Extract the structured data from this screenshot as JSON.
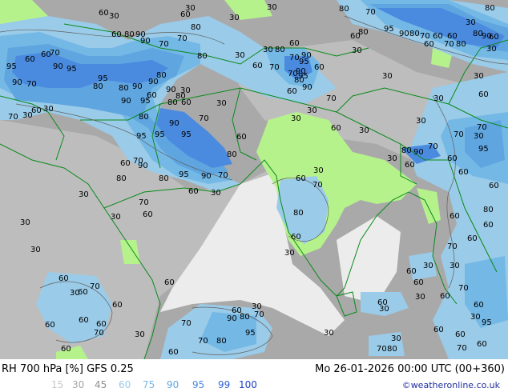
{
  "title": "RH 700 hPa [%] GFS 0.25",
  "run_info": "Mo 26-01-2026 00:00 UTC (00+360)",
  "credit": "©weatheronline.co.uk",
  "legend": [
    {
      "label": "15",
      "color": "#c8c8c8"
    },
    {
      "label": "30",
      "color": "#a5a5a5"
    },
    {
      "label": "45",
      "color": "#8f8f8f"
    },
    {
      "label": "60",
      "color": "#9acbe8"
    },
    {
      "label": "75",
      "color": "#74b8e6"
    },
    {
      "label": "90",
      "color": "#5fa5e0"
    },
    {
      "label": "95",
      "color": "#4a8be0"
    },
    {
      "label": "99",
      "color": "#2e62d6"
    },
    {
      "label": "100",
      "color": "#1c3fc6"
    }
  ],
  "contour_labels": [
    "30",
    "60",
    "70",
    "80",
    "90",
    "95"
  ]
}
